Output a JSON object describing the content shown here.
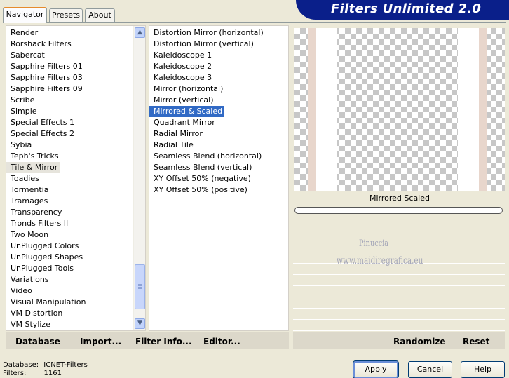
{
  "tabs": [
    "Navigator",
    "Presets",
    "About"
  ],
  "header": {
    "title": "Filters Unlimited 2.0"
  },
  "categories": [
    "Render",
    "Rorshack Filters",
    "Sabercat",
    "Sapphire Filters 01",
    "Sapphire Filters 03",
    "Sapphire Filters 09",
    "Scribe",
    "Simple",
    "Special Effects 1",
    "Special Effects 2",
    "Sybia",
    "Teph's Tricks",
    "Tile & Mirror",
    "Toadies",
    "Tormentia",
    "Tramages",
    "Transparency",
    "Tronds Filters II",
    "Two Moon",
    "UnPlugged Colors",
    "UnPlugged Shapes",
    "UnPlugged Tools",
    "Variations",
    "Video",
    "Visual Manipulation",
    "VM Distortion",
    "VM Stylize"
  ],
  "selected_category": "Tile & Mirror",
  "filters": [
    "Distortion Mirror (horizontal)",
    "Distortion Mirror (vertical)",
    "Kaleidoscope 1",
    "Kaleidoscope 2",
    "Kaleidoscope 3",
    "Mirror (horizontal)",
    "Mirror (vertical)",
    "Mirrored & Scaled",
    "Quadrant Mirror",
    "Radial Mirror",
    "Radial Tile",
    "Seamless Blend (horizontal)",
    "Seamless Blend (vertical)",
    "XY Offset 50% (negative)",
    "XY Offset 50% (positive)"
  ],
  "selected_filter": "Mirrored & Scaled",
  "preview": {
    "filter_name": "Mirrored  Scaled",
    "progress": 0
  },
  "watermark": {
    "line1": "Pinuccia",
    "line2": "www.maidiregrafica.eu"
  },
  "actions": {
    "database": "Database",
    "import": "Import...",
    "filter_info": "Filter Info...",
    "editor": "Editor...",
    "randomize": "Randomize",
    "reset": "Reset"
  },
  "status": {
    "database_label": "Database:",
    "database_value": "ICNET-Filters",
    "filters_label": "Filters:",
    "filters_value": "1161"
  },
  "buttons": {
    "apply": "Apply",
    "cancel": "Cancel",
    "help": "Help"
  },
  "icons": {
    "scroll_up": "chevron-up-icon",
    "scroll_down": "chevron-down-icon"
  },
  "colors": {
    "banner": "#0a1f8a",
    "selection": "#316ac5",
    "tab_accent": "#e68b2c"
  }
}
